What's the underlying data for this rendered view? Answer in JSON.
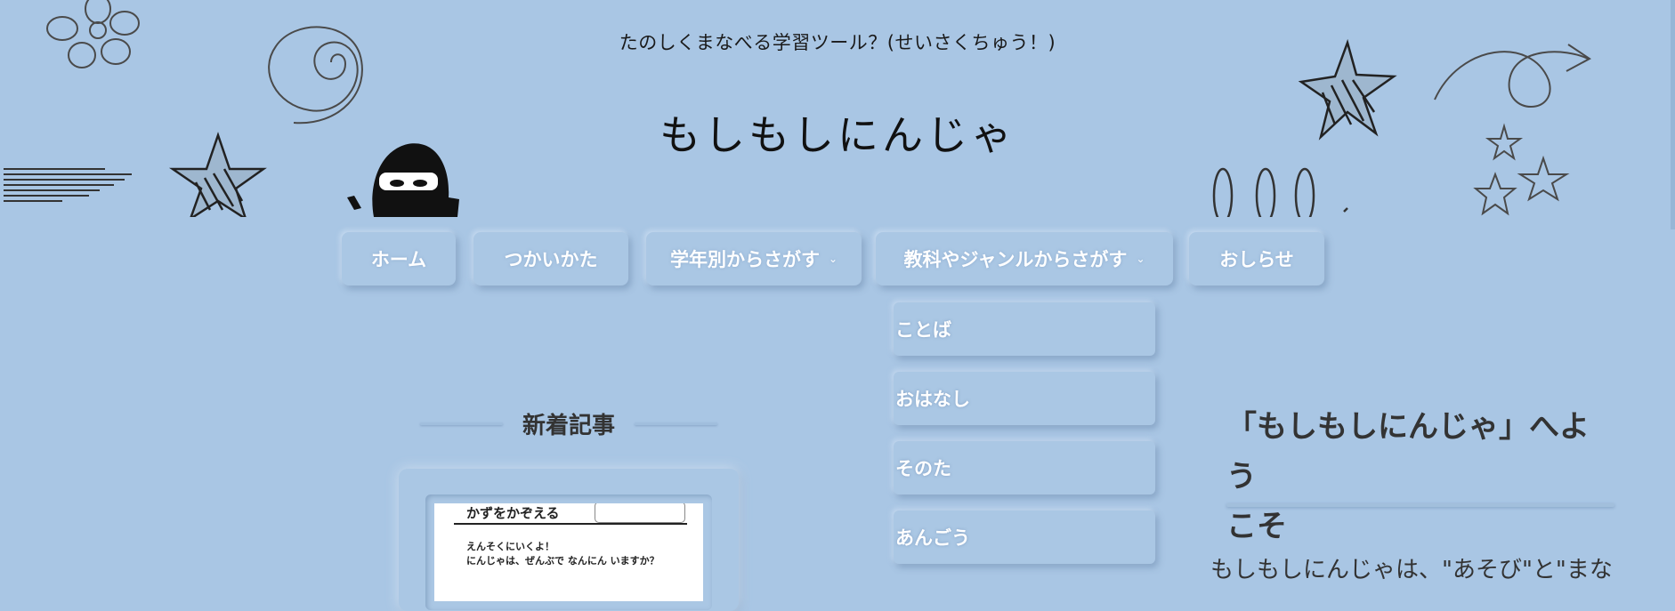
{
  "header": {
    "tagline": "たのしくまなべる学習ツール？(せいさくちゅう！)",
    "site_title": "もしもしにんじゃ",
    "mascot_icon": "ninja-icon"
  },
  "nav": {
    "items": [
      {
        "label": "ホーム",
        "has_dropdown": false
      },
      {
        "label": "つかいかた",
        "has_dropdown": false
      },
      {
        "label": "学年別からさがす",
        "has_dropdown": true
      },
      {
        "label": "教科やジャンルからさがす",
        "has_dropdown": true
      },
      {
        "label": "おしらせ",
        "has_dropdown": false
      }
    ],
    "chevron": "⌄",
    "dropdown": [
      "ことば",
      "おはなし",
      "そのた",
      "あんごう"
    ]
  },
  "sidebar": {
    "widget_title": "新着記事",
    "post_thumb": {
      "heading": "かずをかぞえる",
      "line1": "えんそくにいくよ！",
      "line2": "にんじゃは、ぜんぶで なんにん いますか？"
    }
  },
  "main": {
    "welcome_line1": "「もしもしにんじゃ」へよう",
    "welcome_line2": "こそ",
    "intro": "もしもしにんじゃは、\"あそび\"と\"まな"
  },
  "colors": {
    "background": "#a9c6e4",
    "button_text": "#ffffff",
    "heading_text": "#333333"
  }
}
